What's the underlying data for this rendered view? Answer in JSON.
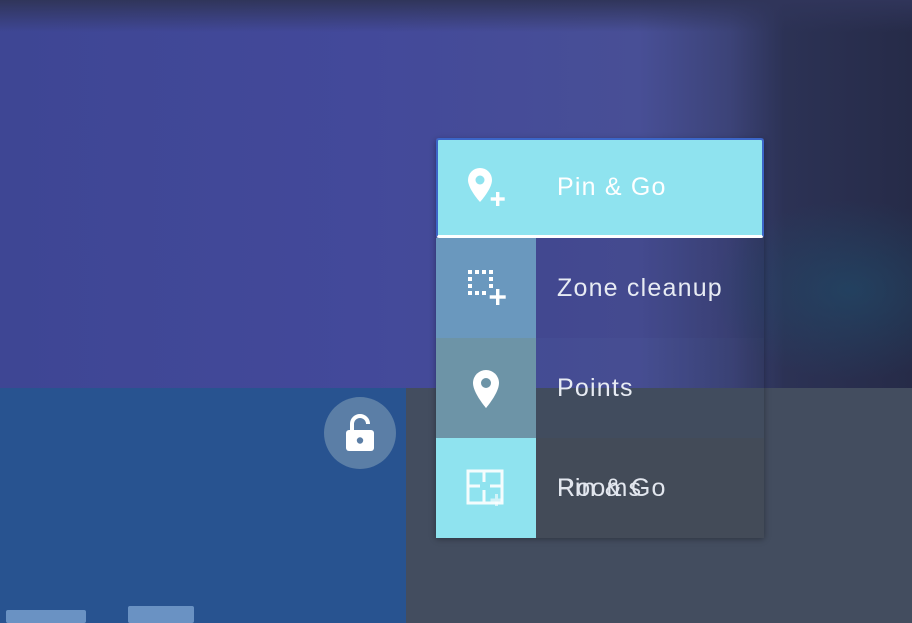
{
  "menu": {
    "items": [
      {
        "label": "Pin & Go",
        "icon": "pin-plus-icon",
        "selected": true
      },
      {
        "label": "Zone cleanup",
        "icon": "zone-plus-icon",
        "selected": false
      },
      {
        "label": "Points",
        "icon": "pin-icon",
        "selected": false
      },
      {
        "label": "Rooms",
        "overlapping_label": "Pin & Go",
        "icon": "floorplan-icon",
        "selected": false
      }
    ]
  },
  "lock_button": {
    "icon": "unlock-icon"
  },
  "colors": {
    "menu_active": "#8fe3ef",
    "menu_active_border": "#3b66c8",
    "map_top": "#43499a",
    "map_bottom_left": "#285390",
    "map_bottom_right": "#434d5f"
  }
}
